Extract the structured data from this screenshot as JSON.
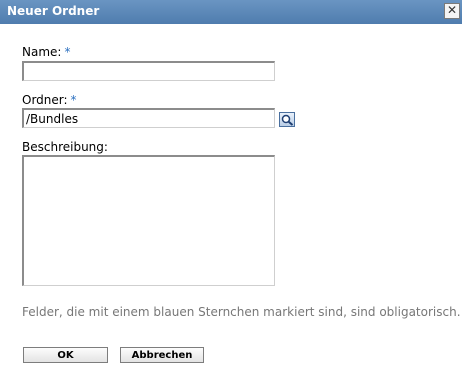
{
  "dialog": {
    "title": "Neuer Ordner",
    "close_glyph": "✕",
    "close_icon": "close-icon"
  },
  "form": {
    "name_label": "Name:",
    "name_required_marker": "*",
    "name_value": "",
    "folder_label": "Ordner:",
    "folder_required_marker": "*",
    "folder_value": "/Bundles",
    "browse_icon": "magnifier-icon",
    "description_label": "Beschreibung:",
    "description_value": "",
    "required_hint": "Felder, die mit einem blauen Sternchen markiert sind, sind obligatorisch.",
    "required_color": "#2a6fbf"
  },
  "buttons": {
    "ok_label": "OK",
    "cancel_label": "Abbrechen"
  }
}
